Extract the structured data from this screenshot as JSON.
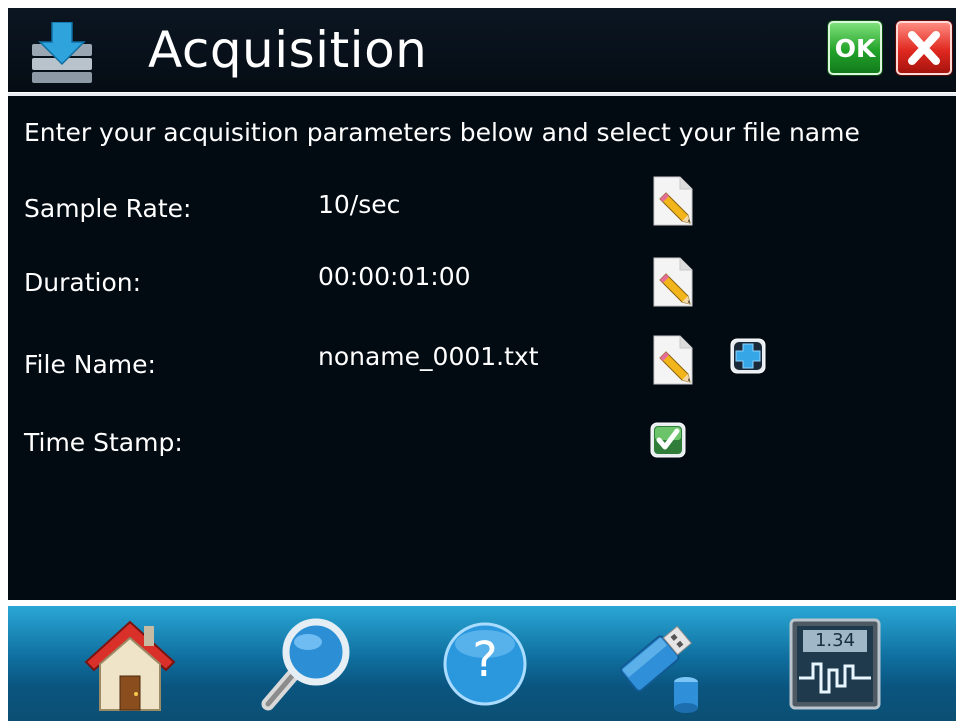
{
  "header": {
    "title": "Acquisition",
    "app_icon": "download-to-storage-icon",
    "ok_label": "OK",
    "close_icon": "close-x-icon",
    "colors": {
      "background": "#07111b",
      "ok": "#23a32a",
      "close": "#e0281f"
    }
  },
  "main": {
    "instructions": "Enter your acquisition parameters below and select your file name",
    "fields": [
      {
        "label": "Sample Rate:",
        "value": "10/sec"
      },
      {
        "label": "Duration:",
        "value": "00:00:01:00"
      },
      {
        "label": "File Name:",
        "value": "noname_0001.txt"
      },
      {
        "label": "Time Stamp:",
        "value": ""
      }
    ],
    "timestamp_checked": true,
    "edit_icon": "edit-pencil-icon",
    "add_icon": "add-plus-icon"
  },
  "navbar": {
    "items": [
      {
        "icon": "home-icon"
      },
      {
        "icon": "search-icon"
      },
      {
        "icon": "help-icon",
        "glyph": "?"
      },
      {
        "icon": "usb-storage-icon"
      },
      {
        "icon": "meter-display-icon",
        "glyph": "1.34"
      }
    ],
    "colors": {
      "top": "#2aa7d6",
      "bottom": "#0c4f73"
    }
  }
}
